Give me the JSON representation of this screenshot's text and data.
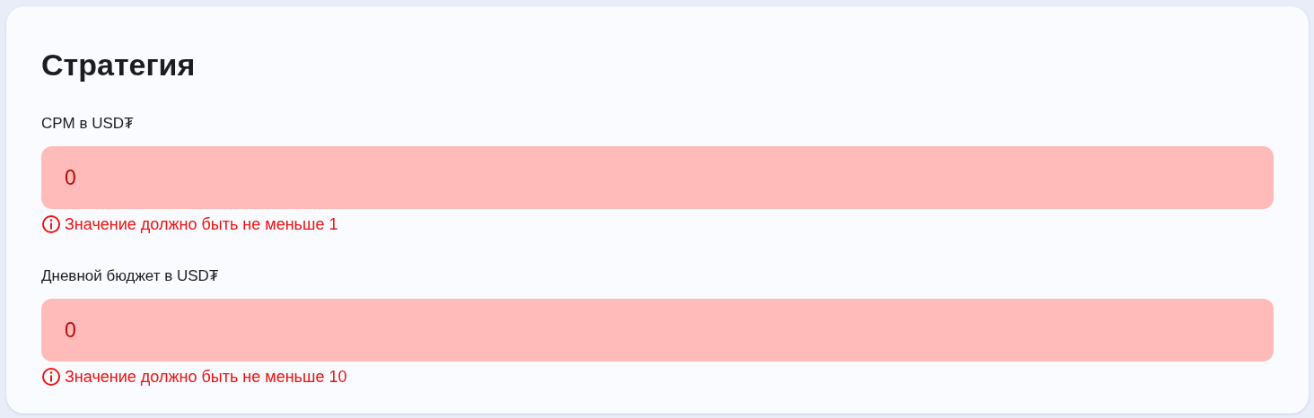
{
  "card": {
    "title": "Стратегия",
    "fields": [
      {
        "label": "CPM в USD₮",
        "value": "0",
        "invalid": true,
        "error": "Значение должно быть не меньше 1"
      },
      {
        "label": "Дневной бюджет в USD₮",
        "value": "0",
        "invalid": true,
        "error": "Значение должно быть не меньше 10"
      }
    ]
  }
}
